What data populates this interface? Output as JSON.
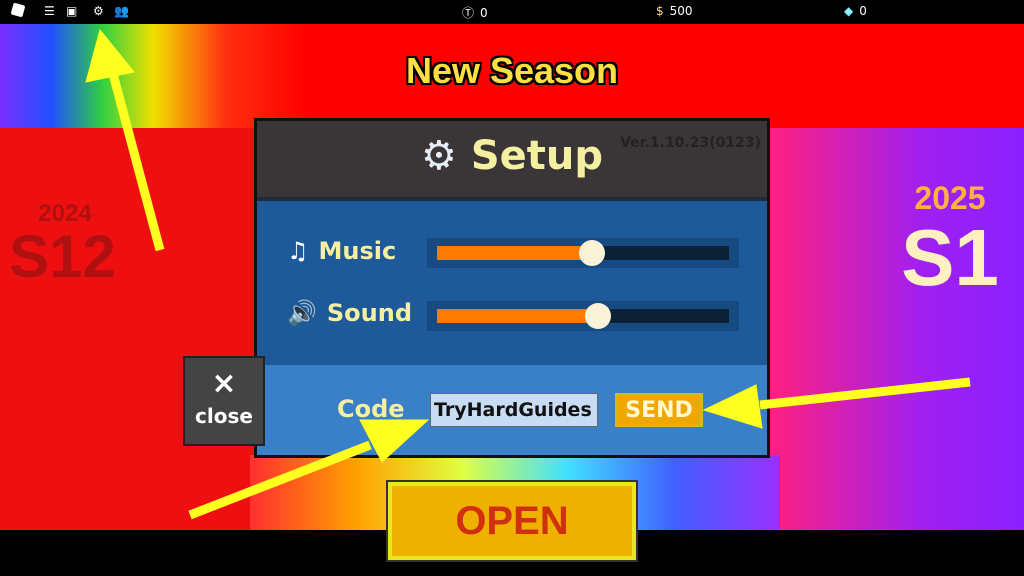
{
  "topbar": {
    "tokens": "0",
    "coins": "500",
    "gems": "0",
    "icons": [
      "roblox-icon",
      "menu-icon",
      "chat-icon",
      "gear-icon",
      "players-icon",
      "token-icon",
      "money-bag-icon",
      "diamond-icon"
    ]
  },
  "banner": {
    "title": "New Season"
  },
  "left_season": {
    "year": "2024",
    "label": "S12"
  },
  "right_season": {
    "year": "2025",
    "label": "S1"
  },
  "setup": {
    "title": "Setup",
    "version": "Ver.1.10.23(0123)",
    "music": {
      "label": "Music",
      "value_percent": 53
    },
    "sound": {
      "label": "Sound",
      "value_percent": 55
    },
    "code": {
      "label": "Code",
      "value": "TryHardGuides",
      "send_label": "SEND"
    }
  },
  "close": {
    "symbol": "×",
    "label": "close"
  },
  "open_label": "OPEN",
  "colors": {
    "slider_fill": "#ff7a00",
    "title_text": "#f5f0a0",
    "send_bg": "#f0a800",
    "arrow": "#ffff20"
  }
}
